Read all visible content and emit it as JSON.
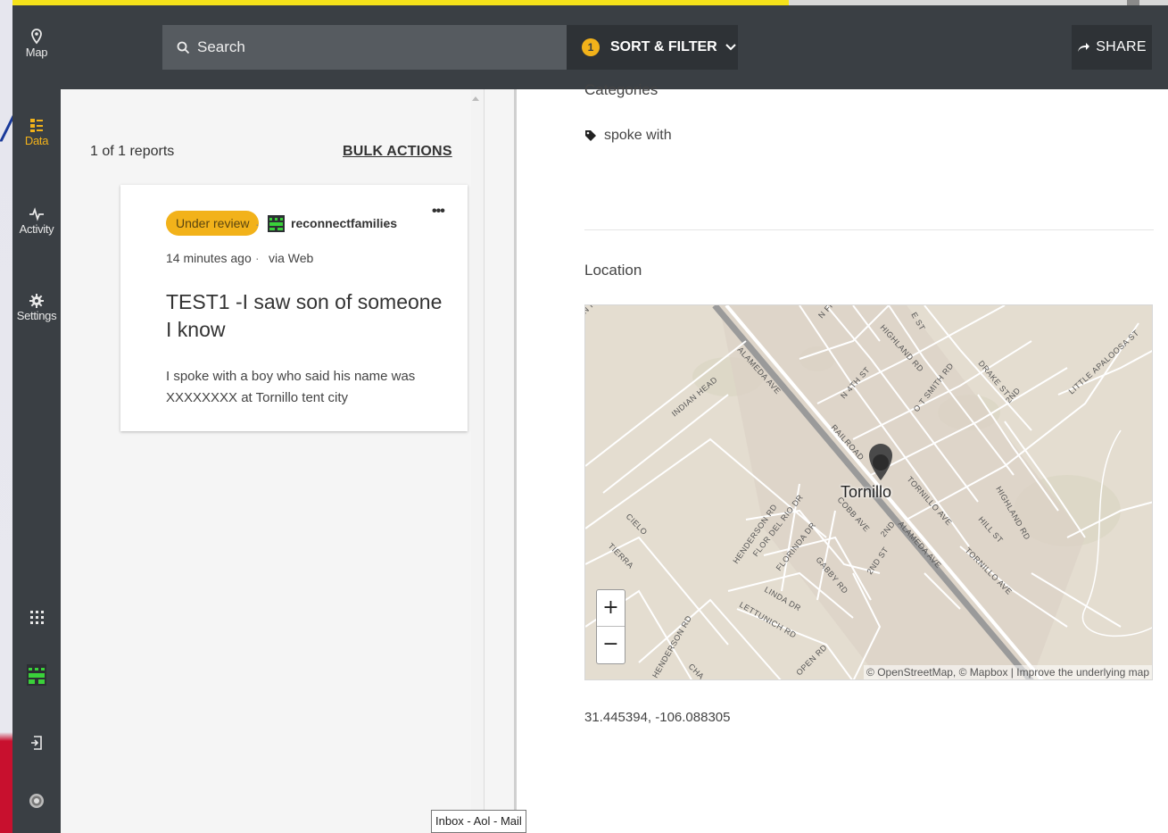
{
  "sidebar": {
    "items": [
      {
        "label": "Map",
        "icon": "map-pin-icon"
      },
      {
        "label": "Data",
        "icon": "data-icon",
        "active": true
      },
      {
        "label": "Activity",
        "icon": "activity-icon"
      },
      {
        "label": "Settings",
        "icon": "gear-icon"
      }
    ],
    "bottom_icons": [
      "apps-grid-icon",
      "deployment-logo-icon",
      "logout-icon",
      "globe-icon"
    ]
  },
  "header": {
    "search_placeholder": "Search",
    "filter_count": "1",
    "sort_filter_label": "SORT & FILTER",
    "share_label": "SHARE"
  },
  "list": {
    "count_text": "1 of 1 reports",
    "bulk_actions_label": "BULK ACTIONS",
    "post": {
      "status": "Under review",
      "author": "reconnectfamilies",
      "time": "14 minutes ago",
      "source": "via Web",
      "title": "TEST1 -I saw son of someone I know",
      "description": "I spoke with a boy who said his name was XXXXXXXX at Tornillo tent city",
      "more_label": "•••"
    }
  },
  "detail": {
    "categories_heading": "Categories",
    "category": "spoke with",
    "location_heading": "Location",
    "map": {
      "place_label": "Tornillo",
      "attribution": "© OpenStreetMap, © Mapbox | Improve the underlying map",
      "zoom_in": "+",
      "zoom_out": "−",
      "street_labels": [
        "ALAMEDA AVE",
        "INDIAN HEAD",
        "RAILROAD",
        "N 4TH ST",
        "HIGHLAND RD",
        "O T SMITH RD",
        "DRAKE ST",
        "2ND",
        "LITTLE APALOOSA ST",
        "HENDERSON RD",
        "FLOR DEL RIO DR",
        "FLORINDA DR",
        "COBB AVE",
        "2ND ST",
        "ALAMEDA AVE",
        "TORNILLO AVE",
        "HILL ST",
        "HIGHLAND RD",
        "TORNILLO AVE",
        "CIELO",
        "TIERRA",
        "GABBY RD",
        "LINDA DR",
        "LETTUNICH RD",
        "N FI",
        "E ST",
        "OPEN RD",
        "HENDERSON RD",
        "CHA"
      ]
    },
    "coordinates": "31.445394, -106.088305"
  },
  "tooltip": "Inbox - Aol - Mail",
  "colors": {
    "sidebar": "#3a3f44",
    "accent": "#f2b21a",
    "map_bg": "#e4ddd0"
  }
}
